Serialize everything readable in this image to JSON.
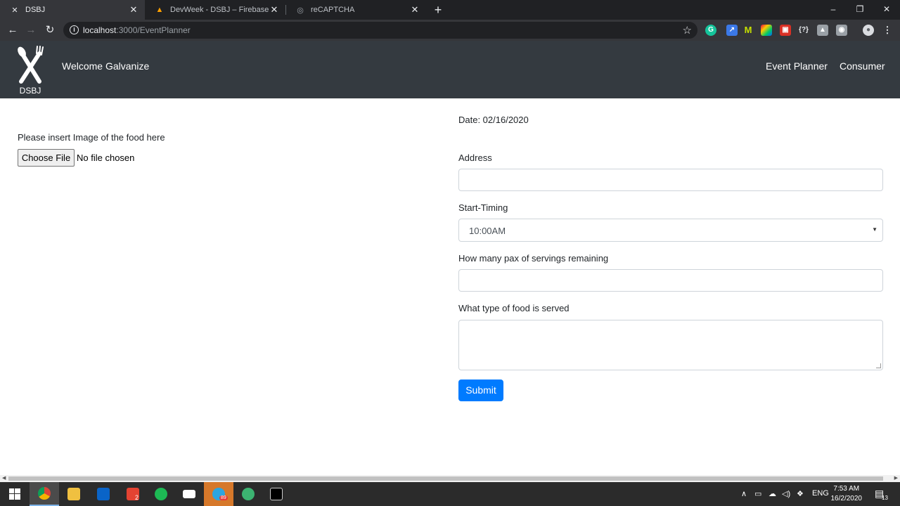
{
  "browser": {
    "tabs": [
      {
        "title": "DSBJ",
        "active": true
      },
      {
        "title": "DevWeek - DSBJ – Firebase cons…",
        "active": false
      },
      {
        "title": "reCAPTCHA",
        "active": false
      }
    ],
    "url_host": "localhost",
    "url_path": ":3000/EventPlanner"
  },
  "navbar": {
    "brand": "DSBJ",
    "welcome": "Welcome Galvanize",
    "links": [
      "Event Planner",
      "Consumer"
    ]
  },
  "left": {
    "image_label": "Please insert Image of the food here",
    "file_button": "Choose File",
    "file_status": "No file chosen"
  },
  "form": {
    "date": "Date: 02/16/2020",
    "address_label": "Address",
    "address_value": "",
    "start_label": "Start-Timing",
    "start_value": "10:00AM",
    "pax_label": "How many pax of servings remaining",
    "pax_value": "",
    "food_label": "What type of food is served",
    "food_value": "",
    "submit": "Submit"
  },
  "taskbar": {
    "language": "ENG",
    "time": "7:53 AM",
    "date": "16/2/2020",
    "todoist_badge": "2",
    "telegram_badge": "89",
    "notification_count": "13"
  },
  "colors": {
    "navbar_bg": "#343a40",
    "primary": "#007bff"
  }
}
